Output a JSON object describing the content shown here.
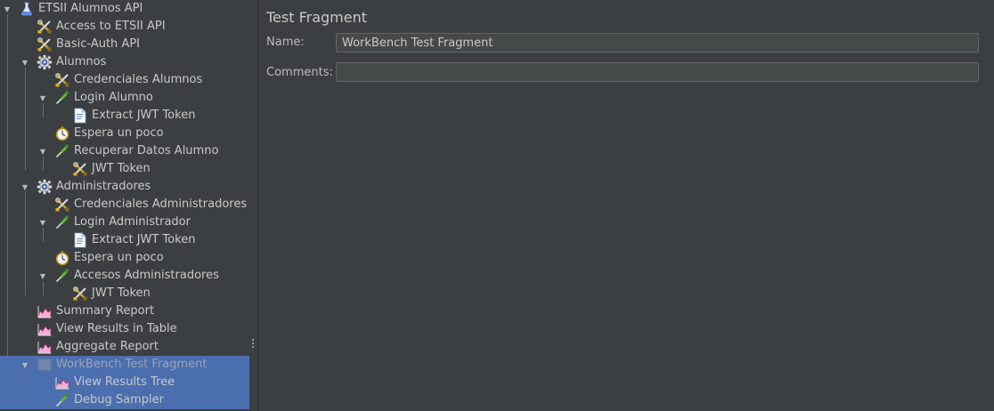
{
  "tree": {
    "items": [
      {
        "label": "ETSII Alumnos API",
        "icon": "flask-icon",
        "depth": 0,
        "expanded": true
      },
      {
        "label": "Access to ETSII API",
        "icon": "config-tools-icon",
        "depth": 1
      },
      {
        "label": "Basic-Auth API",
        "icon": "config-tools-icon",
        "depth": 1
      },
      {
        "label": "Alumnos",
        "icon": "thread-group-gear-icon",
        "depth": 1,
        "expanded": true
      },
      {
        "label": "Credenciales Alumnos",
        "icon": "config-tools-icon",
        "depth": 2
      },
      {
        "label": "Login Alumno",
        "icon": "sampler-pipette-icon",
        "depth": 2,
        "expanded": true
      },
      {
        "label": "Extract JWT Token",
        "icon": "extractor-doc-icon",
        "depth": 3
      },
      {
        "label": "Espera un poco",
        "icon": "timer-clock-icon",
        "depth": 2
      },
      {
        "label": "Recuperar Datos Alumno",
        "icon": "sampler-pipette-icon",
        "depth": 2,
        "expanded": true
      },
      {
        "label": "JWT Token",
        "icon": "config-tools-icon",
        "depth": 3
      },
      {
        "label": "Administradores",
        "icon": "thread-group-gear-icon",
        "depth": 1,
        "expanded": true
      },
      {
        "label": "Credenciales Administradores",
        "icon": "config-tools-icon",
        "depth": 2
      },
      {
        "label": "Login Administrador",
        "icon": "sampler-pipette-icon",
        "depth": 2,
        "expanded": true
      },
      {
        "label": "Extract JWT Token",
        "icon": "extractor-doc-icon",
        "depth": 3
      },
      {
        "label": "Espera un poco",
        "icon": "timer-clock-icon",
        "depth": 2
      },
      {
        "label": "Accesos Administradores",
        "icon": "sampler-pipette-icon",
        "depth": 2,
        "expanded": true
      },
      {
        "label": "JWT Token",
        "icon": "config-tools-icon",
        "depth": 3
      },
      {
        "label": "Summary Report",
        "icon": "listener-chart-icon",
        "depth": 1
      },
      {
        "label": "View Results in Table",
        "icon": "listener-chart-icon",
        "depth": 1
      },
      {
        "label": "Aggregate Report",
        "icon": "listener-chart-icon",
        "depth": 1
      },
      {
        "label": "WorkBench Test Fragment",
        "icon": "test-fragment-icon",
        "depth": 1,
        "expanded": true,
        "selected": true,
        "disabled": true
      },
      {
        "label": "View Results Tree",
        "icon": "listener-chart-icon",
        "depth": 2,
        "selected": true
      },
      {
        "label": "Debug Sampler",
        "icon": "sampler-pipette-icon",
        "depth": 2,
        "selected": true
      }
    ]
  },
  "panel": {
    "title": "Test Fragment",
    "name_label": "Name:",
    "name_value": "WorkBench Test Fragment",
    "comments_label": "Comments:",
    "comments_value": ""
  },
  "colors": {
    "background": "#3c3f41",
    "selection": "#4b6eaf",
    "field_bg": "#45494a",
    "text": "#bbbbbb"
  }
}
